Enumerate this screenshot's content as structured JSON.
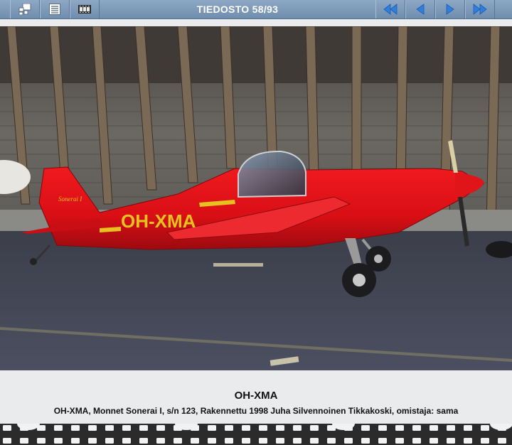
{
  "toolbar": {
    "title": "TIEDOSTO 58/93",
    "buttons": [
      {
        "name": "thumbnails",
        "icon": "thumbnail-grid-icon"
      },
      {
        "name": "list",
        "icon": "list-view-icon"
      },
      {
        "name": "filmstrip",
        "icon": "film-icon"
      }
    ],
    "nav": [
      {
        "name": "first",
        "icon": "first-icon"
      },
      {
        "name": "previous",
        "icon": "previous-icon"
      },
      {
        "name": "next",
        "icon": "next-icon"
      },
      {
        "name": "last",
        "icon": "last-icon"
      }
    ],
    "accent_color": "#2f7fe0"
  },
  "photo": {
    "registration_marking": "OH-XMA",
    "tail_marking": "Sonerai I",
    "aircraft_color": "#e01218"
  },
  "caption": {
    "title": "OH-XMA",
    "text": "OH-XMA, Monnet Sonerai I, s/n 123, Rakennettu 1998 Juha Silvennoinen Tikkakoski, omistaja: sama"
  }
}
